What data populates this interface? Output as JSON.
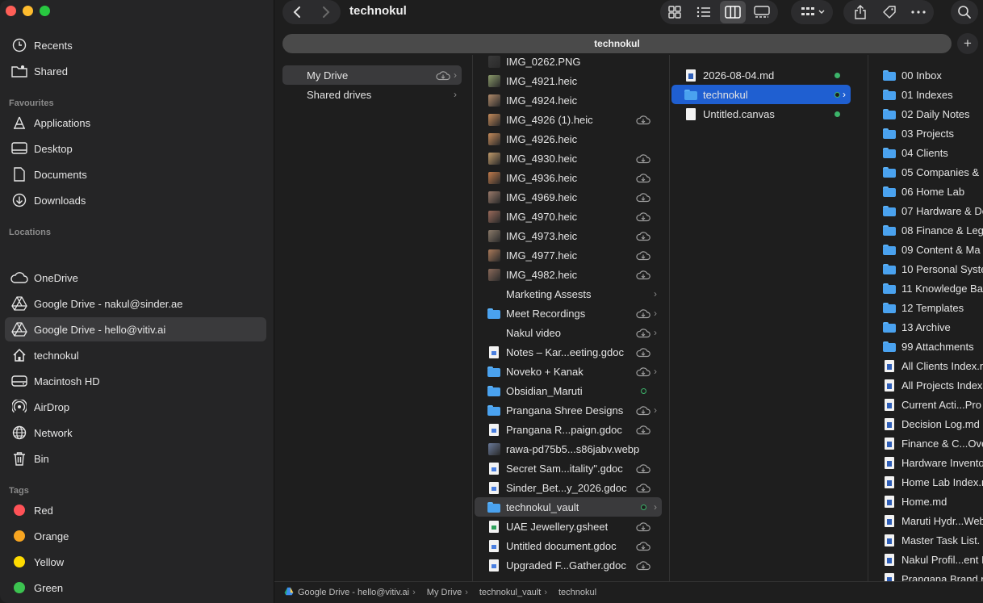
{
  "window": {
    "title": "technokul",
    "tab_title": "technokul",
    "new_tab_label": "+"
  },
  "sidebar": {
    "favourites_heading": "Favourites",
    "locations_heading": "Locations",
    "tags_heading": "Tags",
    "top_items": [
      {
        "label": "Recents",
        "icon": "clock-icon"
      },
      {
        "label": "Shared",
        "icon": "shared-folder-icon"
      }
    ],
    "favourites": [
      {
        "label": "Applications",
        "icon": "applications-icon"
      },
      {
        "label": "Desktop",
        "icon": "desktop-icon"
      },
      {
        "label": "Documents",
        "icon": "document-icon"
      },
      {
        "label": "Downloads",
        "icon": "download-icon"
      }
    ],
    "locations": [
      {
        "label": "OneDrive",
        "icon": "cloud-icon"
      },
      {
        "label": "Google Drive - nakul@sinder.ae",
        "icon": "google-drive-icon"
      },
      {
        "label": "Google Drive - hello@vitiv.ai",
        "icon": "google-drive-icon",
        "selected": true
      },
      {
        "label": "technokul",
        "icon": "home-icon"
      },
      {
        "label": "Macintosh HD",
        "icon": "hard-drive-icon"
      },
      {
        "label": "AirDrop",
        "icon": "airdrop-icon"
      },
      {
        "label": "Network",
        "icon": "network-icon"
      },
      {
        "label": "Bin",
        "icon": "trash-icon"
      }
    ],
    "tags": [
      {
        "label": "Red",
        "color": "#ff5257"
      },
      {
        "label": "Orange",
        "color": "#f7a521"
      },
      {
        "label": "Yellow",
        "color": "#fedb00"
      },
      {
        "label": "Green",
        "color": "#3cc350"
      }
    ]
  },
  "column1": [
    {
      "name": "My Drive",
      "selected": true,
      "cloud": true
    },
    {
      "name": "Shared drives"
    }
  ],
  "column2": [
    {
      "name": "IMG_0262.PNG",
      "kind": "thumb",
      "color": "#3a3a3a"
    },
    {
      "name": "IMG_4921.heic",
      "kind": "thumb",
      "color": "#8a9a6a",
      "cloud": false
    },
    {
      "name": "IMG_4924.heic",
      "kind": "thumb",
      "color": "#b08a6a"
    },
    {
      "name": "IMG_4926 (1).heic",
      "kind": "thumb",
      "color": "#c48a5a",
      "cloud": true
    },
    {
      "name": "IMG_4926.heic",
      "kind": "thumb",
      "color": "#c48a5a"
    },
    {
      "name": "IMG_4930.heic",
      "kind": "thumb",
      "color": "#c09a6a",
      "cloud": true
    },
    {
      "name": "IMG_4936.heic",
      "kind": "thumb",
      "color": "#c07a4a",
      "cloud": true
    },
    {
      "name": "IMG_4969.heic",
      "kind": "thumb",
      "color": "#9a7a6a",
      "cloud": true
    },
    {
      "name": "IMG_4970.heic",
      "kind": "thumb",
      "color": "#9a6a5a",
      "cloud": true
    },
    {
      "name": "IMG_4973.heic",
      "kind": "thumb",
      "color": "#8a7a6a",
      "cloud": true
    },
    {
      "name": "IMG_4977.heic",
      "kind": "thumb",
      "color": "#aa7a5a",
      "cloud": true
    },
    {
      "name": "IMG_4982.heic",
      "kind": "thumb",
      "color": "#8a6a5a",
      "cloud": true
    },
    {
      "name": "Marketing Assests",
      "kind": "none",
      "chevron": true
    },
    {
      "name": "Meet Recordings",
      "kind": "folder",
      "cloud": true,
      "chevron": true
    },
    {
      "name": "Nakul video",
      "kind": "none",
      "cloud": true,
      "chevron": true
    },
    {
      "name": "Notes – Kar...eeting.gdoc",
      "kind": "gdoc",
      "cloud": true
    },
    {
      "name": "Noveko + Kanak",
      "kind": "folder",
      "cloud": true,
      "chevron": true
    },
    {
      "name": "Obsidian_Maruti",
      "kind": "folder",
      "synced": true
    },
    {
      "name": "Prangana   Shree Designs",
      "kind": "folder",
      "cloud": true,
      "chevron": true
    },
    {
      "name": "Prangana R...paign.gdoc",
      "kind": "gdoc",
      "cloud": true
    },
    {
      "name": "rawa-pd75b5...s86jabv.webp",
      "kind": "thumb",
      "color": "#6a7a9a"
    },
    {
      "name": "Secret Sam...itality\".gdoc",
      "kind": "gdoc",
      "cloud": true
    },
    {
      "name": "Sinder_Bet...y_2026.gdoc",
      "kind": "gdoc",
      "cloud": true
    },
    {
      "name": "technokul_vault",
      "kind": "folder",
      "synced": true,
      "chevron": true,
      "selected": true
    },
    {
      "name": "UAE Jewellery.gsheet",
      "kind": "gsheet",
      "cloud": true
    },
    {
      "name": "Untitled document.gdoc",
      "kind": "gdoc",
      "cloud": true
    },
    {
      "name": "Upgraded F...Gather.gdoc",
      "kind": "gdoc",
      "cloud": true
    }
  ],
  "column3": [
    {
      "name": "2026-08-04.md",
      "kind": "md",
      "synced": true
    },
    {
      "name": "technokul",
      "kind": "folder",
      "synced": true,
      "chevron": true,
      "selected": true
    },
    {
      "name": "Untitled.canvas",
      "kind": "doc",
      "synced": true
    }
  ],
  "column4": [
    {
      "name": "00 Inbox",
      "kind": "folder"
    },
    {
      "name": "01 Indexes",
      "kind": "folder"
    },
    {
      "name": "02 Daily Notes",
      "kind": "folder"
    },
    {
      "name": "03 Projects",
      "kind": "folder"
    },
    {
      "name": "04 Clients",
      "kind": "folder"
    },
    {
      "name": "05 Companies &",
      "kind": "folder"
    },
    {
      "name": "06 Home Lab",
      "kind": "folder"
    },
    {
      "name": "07 Hardware & Do",
      "kind": "folder"
    },
    {
      "name": "08 Finance & Leg",
      "kind": "folder"
    },
    {
      "name": "09 Content & Ma",
      "kind": "folder"
    },
    {
      "name": "10 Personal Syste",
      "kind": "folder"
    },
    {
      "name": "11 Knowledge Bas",
      "kind": "folder"
    },
    {
      "name": "12 Templates",
      "kind": "folder"
    },
    {
      "name": "13 Archive",
      "kind": "folder"
    },
    {
      "name": "99 Attachments",
      "kind": "folder"
    },
    {
      "name": "All Clients Index.n",
      "kind": "md"
    },
    {
      "name": "All Projects Index",
      "kind": "md"
    },
    {
      "name": "Current Acti...Pro",
      "kind": "md"
    },
    {
      "name": "Decision Log.md",
      "kind": "md"
    },
    {
      "name": "Finance & C...Ove",
      "kind": "md"
    },
    {
      "name": "Hardware Invento",
      "kind": "md"
    },
    {
      "name": "Home Lab Index.n",
      "kind": "md"
    },
    {
      "name": "Home.md",
      "kind": "md"
    },
    {
      "name": "Maruti Hydr...Web",
      "kind": "md"
    },
    {
      "name": "Master Task List.",
      "kind": "md"
    },
    {
      "name": "Nakul Profil...ent I",
      "kind": "md"
    },
    {
      "name": "Prangana Brand n",
      "kind": "md"
    }
  ],
  "pathbar": [
    {
      "label": "Google Drive - hello@vitiv.ai",
      "icon": "google-drive-icon"
    },
    {
      "label": "My Drive"
    },
    {
      "label": "technokul_vault"
    },
    {
      "label": "technokul"
    }
  ],
  "colors": {
    "selection_blue": "#1f5fd1",
    "selection_grey": "#3a3a3c",
    "folder_blue": "#4aa2ef",
    "sync_green": "#3cb46a"
  }
}
